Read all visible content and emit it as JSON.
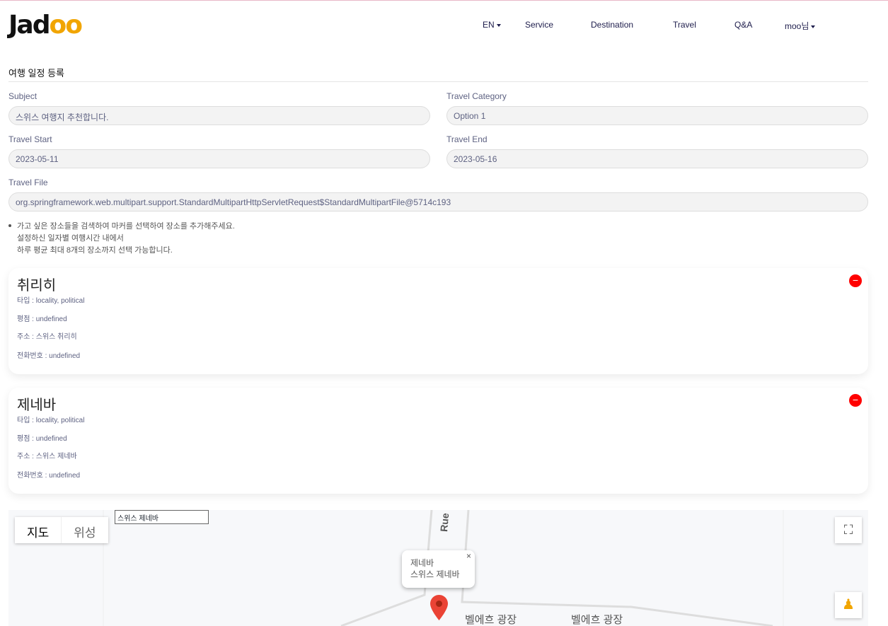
{
  "brand": {
    "name_a": "Jad",
    "name_b": "oo"
  },
  "nav": {
    "lang": "EN",
    "items": [
      "Service",
      "Destination",
      "Travel",
      "Q&A"
    ],
    "user": "moo님"
  },
  "form": {
    "title": "여행 일정 등록",
    "subject_label": "Subject",
    "subject_value": "스위스 여행지 추천합니다.",
    "category_label": "Travel Category",
    "category_value": "Option 1",
    "start_label": "Travel Start",
    "start_value": "2023-05-11",
    "end_label": "Travel End",
    "end_value": "2023-05-16",
    "file_label": "Travel File",
    "file_value": "org.springframework.web.multipart.support.StandardMultipartHttpServletRequest$StandardMultipartFile@5714c193"
  },
  "note": [
    "가고 싶은 장소들을 검색하여 마커를 선택하여 장소를 추가해주세요.",
    "설정하신 일자별 여행시간 내에서",
    "하루 평균 최대 8개의 장소까지 선택 가능합니다."
  ],
  "places": [
    {
      "name": "취리히",
      "type": "타입 : locality, political",
      "rating": "평점 : undefined",
      "address": "주소 : 스위스 취리히",
      "phone": "전화번호 : undefined"
    },
    {
      "name": "제네바",
      "type": "타입 : locality, political",
      "rating": "평점 : undefined",
      "address": "주소 : 스위스 제네바",
      "phone": "전화번호 : undefined"
    }
  ],
  "map": {
    "type_map": "지도",
    "type_satellite": "위성",
    "search_value": "스위스 제네바",
    "info_title": "제네바",
    "info_address": "스위스 제네바",
    "close": "×",
    "road": "Rue de",
    "labels": [
      "벨에흐 광장",
      "벨에흐 광장"
    ]
  },
  "colors": {
    "accent": "#f1a501",
    "remove": "#ff0000"
  }
}
